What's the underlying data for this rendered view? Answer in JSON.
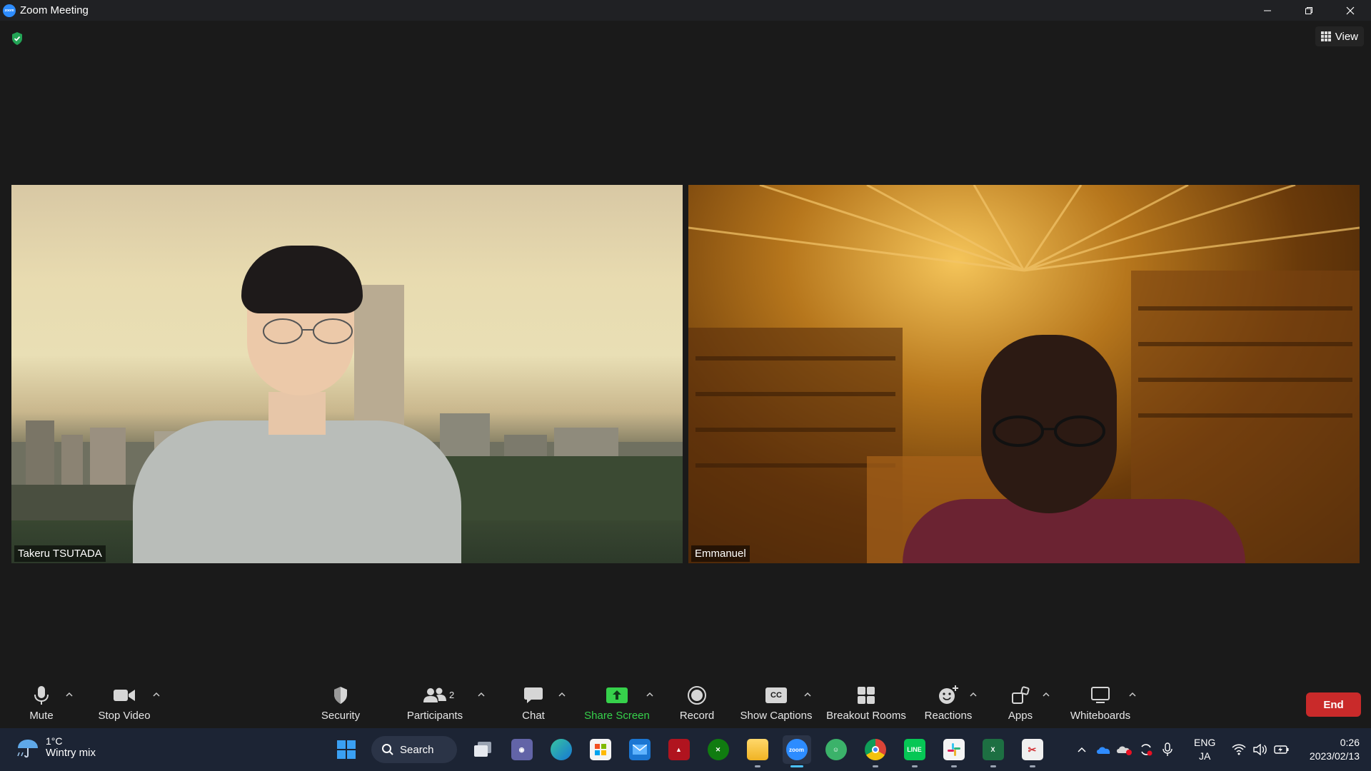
{
  "window": {
    "title": "Zoom Meeting"
  },
  "header": {
    "view_label": "View"
  },
  "participants": [
    {
      "name": "Takeru TSUTADA"
    },
    {
      "name": "Emmanuel"
    }
  ],
  "toolbar": {
    "mute": "Mute",
    "stop_video": "Stop Video",
    "security": "Security",
    "participants": "Participants",
    "participants_count": "2",
    "chat": "Chat",
    "share_screen": "Share Screen",
    "record": "Record",
    "show_captions": "Show Captions",
    "captions_icon": "CC",
    "breakout_rooms": "Breakout Rooms",
    "reactions": "Reactions",
    "apps": "Apps",
    "whiteboards": "Whiteboards",
    "end": "End"
  },
  "taskbar": {
    "weather_temp": "1°C",
    "weather_desc": "Wintry mix",
    "search_label": "Search",
    "zoom_icon_text": "zoom",
    "lang_top": "ENG",
    "lang_bottom": "JA",
    "time": "0:26",
    "date": "2023/02/13"
  },
  "colors": {
    "share_green": "#36d14b",
    "end_red": "#c92a2a",
    "zoom_blue": "#2d8cff",
    "taskbar_bg": "#1c2434"
  }
}
